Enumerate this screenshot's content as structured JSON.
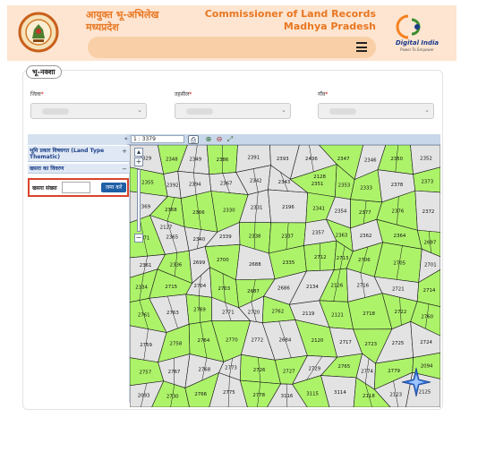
{
  "header": {
    "title_hi_line1": "आयुक्त भू-अभिलेख",
    "title_hi_line2": "मध्यप्रदेश",
    "title_en_line1": "Commissioner of Land Records",
    "title_en_line2": "Madhya Pradesh",
    "digital_india": "Digital India",
    "digital_india_tagline": "Power To Empower",
    "menu_icon": "hamburger-icon"
  },
  "panel": {
    "legend": "भू-नक्शा",
    "district_label": "जिला",
    "tehsil_label": "तहसील",
    "village_label": "गाँव",
    "required_mark": "*"
  },
  "map_toolbar": {
    "scale": "1 : 3379",
    "collapse_icon": "double-chevron-left-icon"
  },
  "left_panel": {
    "land_type_title": "भूमि प्रकार विषयगत (Land Type Thematic)",
    "khasra_details_title": "खसरा का विवरण",
    "khasra_number_label": "खसरा संख्या",
    "khasra_input_value": "",
    "submit_label": "जमा करें"
  },
  "map": {
    "green": "#adf36a",
    "gray": "#e3e3e3",
    "plot_numbers": [
      "2329",
      "2348",
      "2349",
      "2386",
      "2391",
      "2393",
      "2436",
      "2347",
      "2346",
      "2350",
      "2352",
      "2355",
      "2392",
      "2394",
      "2367",
      "2342",
      "2343",
      "2351",
      "2353",
      "2333",
      "2378",
      "2373",
      "2369",
      "2368",
      "2366",
      "2330",
      "2331",
      "2196",
      "2341",
      "2354",
      "2377",
      "2376",
      "2372",
      "2371",
      "2365",
      "2340",
      "2339",
      "2338",
      "2337",
      "2357",
      "2363",
      "2362",
      "2364",
      "2697",
      "2361",
      "2336",
      "2699",
      "2700",
      "2688",
      "2335",
      "2712",
      "2713",
      "2706",
      "2705",
      "2701",
      "2334",
      "2715",
      "2704",
      "2703",
      "2687",
      "2686",
      "2134",
      "2126",
      "2716",
      "2721",
      "2714",
      "2761",
      "2763",
      "2769",
      "2771",
      "2720",
      "2762",
      "2119",
      "2121",
      "2718",
      "2722",
      "2760",
      "2759",
      "2758",
      "2764",
      "2770",
      "2772",
      "2684",
      "2120",
      "2717",
      "2723",
      "2725",
      "2724",
      "2757",
      "2767",
      "2768",
      "2773",
      "2726",
      "2727",
      "2729",
      "2765",
      "2774",
      "2779",
      "2094",
      "2093",
      "2730",
      "2766",
      "2775",
      "2778",
      "3116",
      "3115",
      "3114",
      "2118",
      "2123",
      "2125",
      "2128",
      "2127"
    ]
  }
}
